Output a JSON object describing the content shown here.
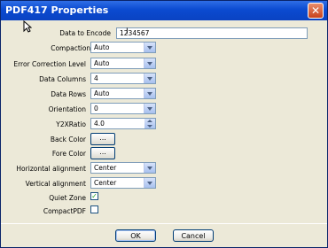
{
  "window": {
    "title": "PDF417 Properties",
    "close_glyph": "✕"
  },
  "fields": {
    "data_to_encode": {
      "label": "Data to Encode",
      "value": "1234567"
    },
    "compaction_mode": {
      "label": "Compaction Mode",
      "value": "Auto"
    },
    "error_correction": {
      "label": "Error Correction Level",
      "value": "Auto"
    },
    "data_columns": {
      "label": "Data Columns",
      "value": "4"
    },
    "data_rows": {
      "label": "Data Rows",
      "value": "Auto"
    },
    "orientation": {
      "label": "Orientation",
      "value": "0"
    },
    "y2x_ratio": {
      "label": "Y2XRatio",
      "value": "4.0"
    },
    "back_color": {
      "label": "Back Color",
      "button": "..."
    },
    "fore_color": {
      "label": "Fore Color",
      "button": "..."
    },
    "horizontal_alignment": {
      "label": "Horizontal alignment",
      "value": "Center"
    },
    "vertical_alignment": {
      "label": "Vertical alignment",
      "value": "Center"
    },
    "quiet_zone": {
      "label": "Quiet Zone",
      "checked": true
    },
    "compact_pdf": {
      "label": "CompactPDF",
      "checked": false
    }
  },
  "buttons": {
    "ok": "OK",
    "cancel": "Cancel"
  },
  "icons": {
    "checkmark": "✓",
    "mouse": "pointer-cursor-icon",
    "text_cursor": "I"
  }
}
